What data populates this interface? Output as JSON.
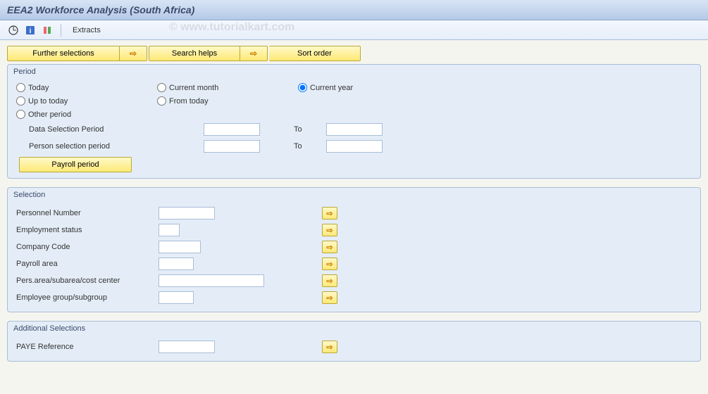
{
  "title": "EEA2 Workforce Analysis (South Africa)",
  "watermark": "© www.tutorialkart.com",
  "toolbar": {
    "extracts": "Extracts"
  },
  "buttons": {
    "further": "Further selections",
    "search": "Search helps",
    "sort": "Sort order"
  },
  "period": {
    "legend": "Period",
    "today": "Today",
    "current_month": "Current month",
    "current_year": "Current year",
    "up_to_today": "Up to today",
    "from_today": "From today",
    "other": "Other period",
    "data_sel": "Data Selection Period",
    "person_sel": "Person selection period",
    "to": "To",
    "payroll": "Payroll period"
  },
  "selection": {
    "legend": "Selection",
    "fields": [
      {
        "label": "Personnel Number"
      },
      {
        "label": "Employment status"
      },
      {
        "label": "Company Code"
      },
      {
        "label": "Payroll area"
      },
      {
        "label": "Pers.area/subarea/cost center"
      },
      {
        "label": "Employee group/subgroup"
      }
    ]
  },
  "additional": {
    "legend": "Additional Selections",
    "paye": "PAYE Reference"
  }
}
